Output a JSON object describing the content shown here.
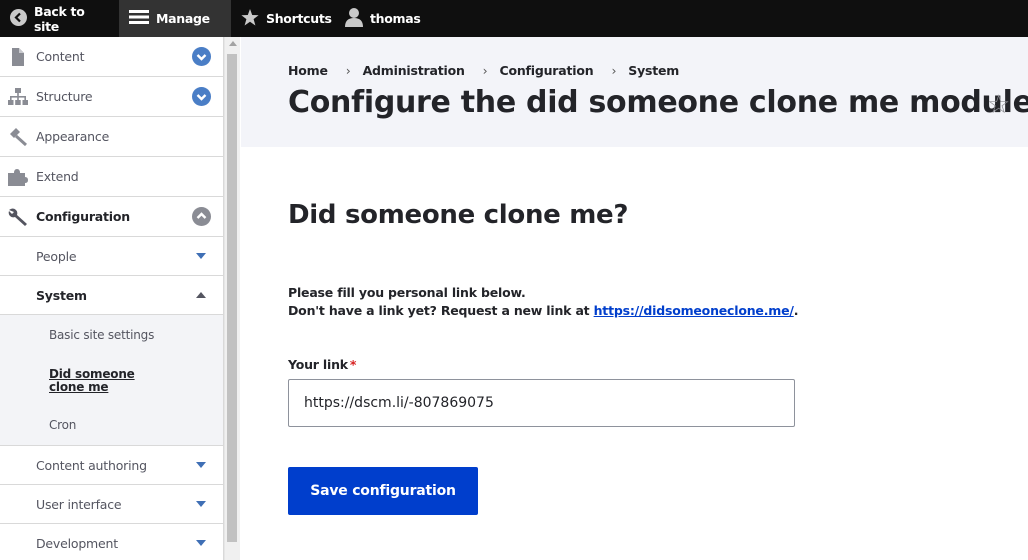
{
  "toolbar": {
    "back_label": "Back to site",
    "manage_label": "Manage",
    "shortcuts_label": "Shortcuts",
    "user_label": "thomas"
  },
  "sidebar": {
    "items": [
      {
        "label": "Content",
        "icon": "file-icon"
      },
      {
        "label": "Structure",
        "icon": "sitemap-icon"
      },
      {
        "label": "Appearance",
        "icon": "paintbrush-icon"
      },
      {
        "label": "Extend",
        "icon": "puzzle-icon"
      },
      {
        "label": "Configuration",
        "icon": "wrench-icon"
      }
    ],
    "config_children": [
      {
        "label": "People"
      },
      {
        "label": "System"
      }
    ],
    "system_children": [
      {
        "label": "Basic site settings"
      },
      {
        "label": "Did someone clone me"
      },
      {
        "label": "Cron"
      }
    ],
    "more": [
      {
        "label": "Content authoring"
      },
      {
        "label": "User interface"
      },
      {
        "label": "Development"
      }
    ]
  },
  "breadcrumb": [
    "Home",
    "Administration",
    "Configuration",
    "System"
  ],
  "page_title": "Configure the did someone clone me module",
  "form": {
    "heading": "Did someone clone me?",
    "description_line1": "Please fill you personal link below.",
    "description_line2_prefix": "Don't have a link yet? Request a new link at ",
    "description_link": "https://didsomeoneclone.me/",
    "description_line2_suffix": ".",
    "link_label": "Your link",
    "required_marker": "*",
    "link_value": "https://dscm.li/-807869075",
    "save_label": "Save configuration"
  },
  "colors": {
    "toolbar_bg": "#0f0f0f",
    "accent": "#003ecc",
    "header_bg": "#f3f4f9",
    "chevron_blue": "#4a7ec6",
    "required": "#d72222"
  }
}
